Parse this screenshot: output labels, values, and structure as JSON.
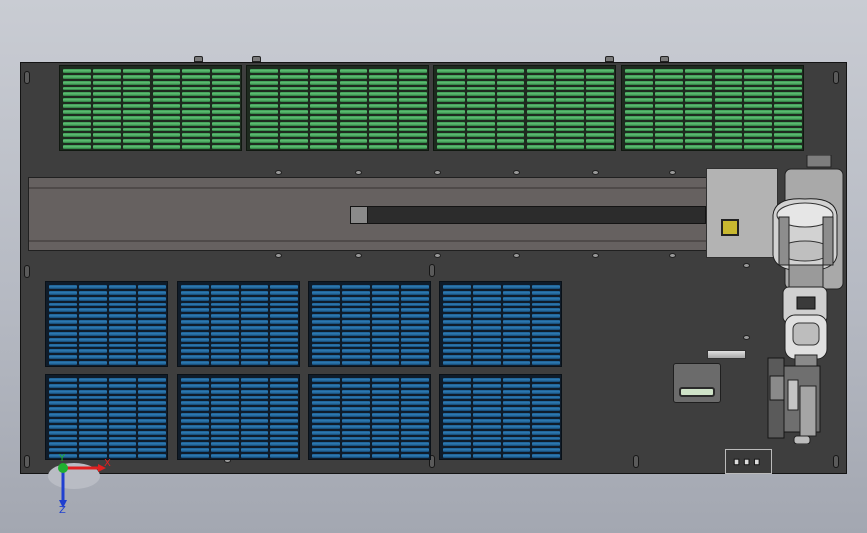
{
  "scene": {
    "type": "cad-top-view",
    "background_colors": [
      "#c9ccd3",
      "#a3a7b1"
    ],
    "plate_color": "#3e3e3e",
    "green_rack_color": "#5fbf74",
    "blue_rack_color": "#2f7cb5",
    "rail_color": "#666160",
    "robot_color": "#c9c9c9"
  },
  "axis_triad": {
    "x_label": "X",
    "y_label": "Y",
    "z_label": "Z",
    "x_color": "#e02020",
    "y_color": "#20b030",
    "z_color": "#2040d0"
  },
  "icons": {
    "axis": "axis-triad-icon",
    "robot": "robot-arm-icon"
  }
}
